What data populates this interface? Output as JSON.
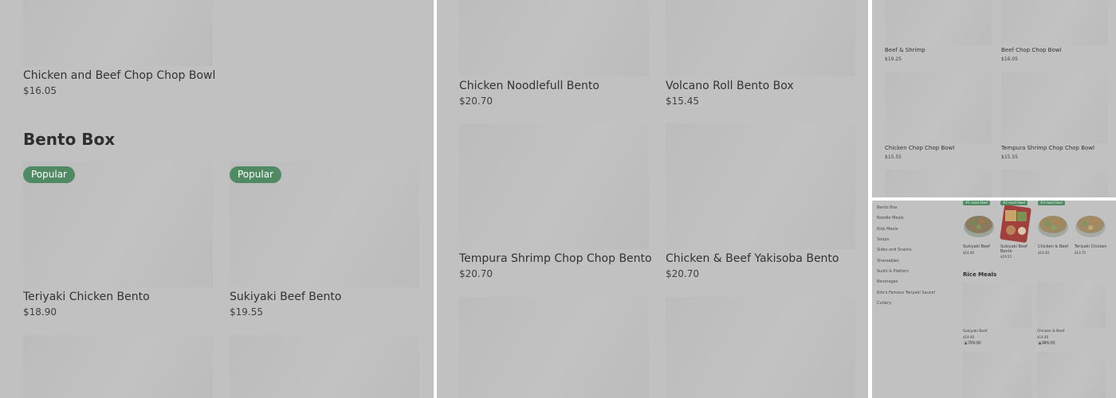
{
  "panel1": {
    "prev_item": {
      "name": "Chicken and Beef Chop Chop Bowl",
      "price": "$16.05"
    },
    "section_title": "Bento Box",
    "items": [
      {
        "name": "Teriyaki Chicken Bento",
        "price": "$18.90",
        "badge": "Popular"
      },
      {
        "name": "Sukiyaki Beef Bento",
        "price": "$19.55",
        "badge": "Popular"
      }
    ]
  },
  "panel2": {
    "items": [
      {
        "name": "Chicken Noodlefull Bento",
        "price": "$20.70"
      },
      {
        "name": "Volcano Roll Bento Box",
        "price": "$15.45"
      },
      {
        "name": "Tempura Shrimp Chop Chop Bento",
        "price": "$20.70"
      },
      {
        "name": "Chicken & Beef Yakisoba Bento",
        "price": "$20.70"
      }
    ]
  },
  "panel3": {
    "items": [
      {
        "name": "Beef & Shrimp",
        "price": "$19.25"
      },
      {
        "name": "Beef Chop Chop Bowl",
        "price": "$16.05"
      },
      {
        "name": "Chicken Chop Chop Bowl",
        "price": "$15.55"
      },
      {
        "name": "Tempura Shrimp Chop Chop Bowl",
        "price": "$15.55"
      }
    ]
  },
  "panel4": {
    "categories": [
      "Bento Box",
      "Noodle Meals",
      "Kids Meals",
      "Soups",
      "Sides and Snacks",
      "Shareables",
      "Sushi & Platters",
      "Beverages",
      "Edo's Famous Teriyaki Sauce!",
      "Cutlery"
    ],
    "top_items": [
      {
        "name_line1": "Sukiyaki Beef",
        "name_line2": "",
        "price": "$14.40",
        "badge": "#1 most liked"
      },
      {
        "name_line1": "Sukiyaki Beef",
        "name_line2": "Bento",
        "price": "$19.55",
        "badge": "#2 most liked"
      },
      {
        "name_line1": "Chicken & Beef",
        "name_line2": "",
        "price": "$14.40",
        "badge": "#3 most liked"
      },
      {
        "name_line1": "Teriyaki Chicken",
        "name_line2": "",
        "price": "$13.75",
        "badge": ""
      }
    ],
    "section_title": "Rice Meals",
    "rice_items": [
      {
        "name": "Sukiyaki Beef",
        "price": "$14.40",
        "rating": "75% (8)"
      },
      {
        "name": "Chicken & Beef",
        "price": "$14.40",
        "rating": "88% (9)"
      }
    ]
  }
}
